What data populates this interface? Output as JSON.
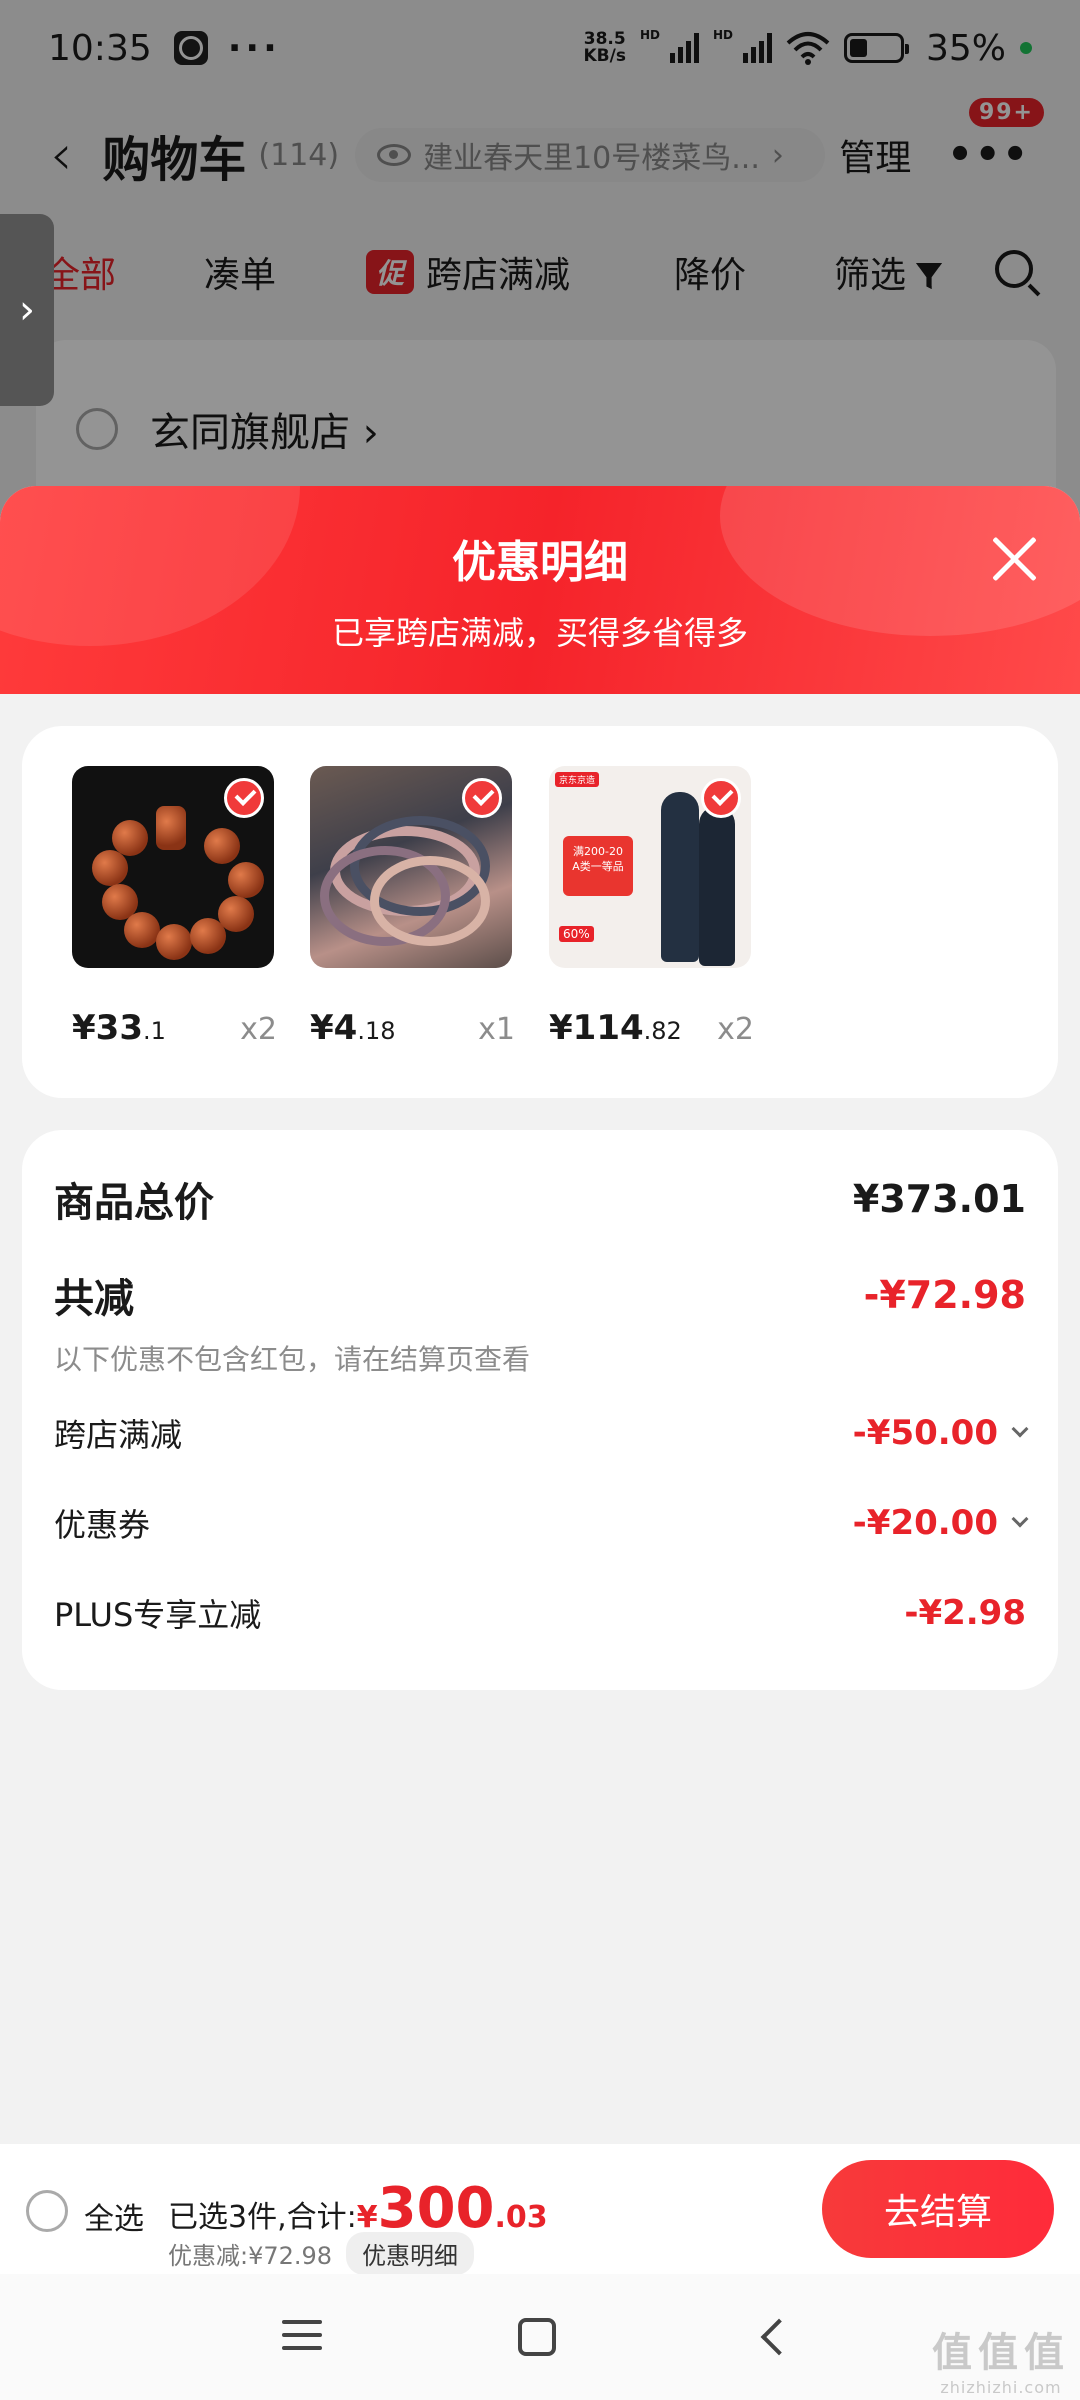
{
  "status_bar": {
    "time": "10:35",
    "dots": "···",
    "net_speed_value": "38.5",
    "net_speed_unit": "KB/s",
    "hd1": "HD",
    "hd2": "HD",
    "battery_percent": "35%",
    "battery_level": 0.35
  },
  "header": {
    "back_glyph": "‹",
    "title": "购物车",
    "count": "(114)",
    "address": "建业春天里10号楼菜鸟...",
    "address_chevron": "›",
    "manage": "管理",
    "more_glyph": "•••",
    "badge": "99+"
  },
  "filter_tabs": [
    {
      "label": "全部"
    },
    {
      "label": "凑单"
    },
    {
      "label": "跨店满减",
      "tag": "促"
    },
    {
      "label": "降价"
    },
    {
      "label": "筛选"
    }
  ],
  "side_tab_glyph": "›",
  "store": {
    "name": "玄同旗舰店 ›"
  },
  "sheet": {
    "title": "优惠明细",
    "subtitle": "已享跨店满减，买得多省得多"
  },
  "products": [
    {
      "price_int": "¥33",
      "price_dec": ".1",
      "qty": "x2",
      "icon": "bracelet"
    },
    {
      "price_int": "¥4",
      "price_dec": ".18",
      "qty": "x1",
      "icon": "hair-ties"
    },
    {
      "price_int": "¥114",
      "price_dec": ".82",
      "qty": "x2",
      "icon": "thermal-underwear"
    }
  ],
  "product_image_text": {
    "brand": "京东京造",
    "promo": "满200-20",
    "promo2": "A类一等品",
    "pct": "60%"
  },
  "summary": {
    "total_label": "商品总价",
    "total_value": "¥373.01",
    "reduce_label": "共减",
    "reduce_value": "-¥72.98",
    "note": "以下优惠不包含红包，请在结算页查看",
    "items": [
      {
        "label": "跨店满减",
        "value": "-¥50.00",
        "expandable": true
      },
      {
        "label": "优惠券",
        "value": "-¥20.00",
        "expandable": true
      },
      {
        "label": "PLUS专享立减",
        "value": "-¥2.98",
        "expandable": false
      }
    ]
  },
  "checkout": {
    "select_all": "全选",
    "selected_text": "已选3件,合计:",
    "currency": "¥",
    "amount_int": "300",
    "amount_dec": ".03",
    "discount_text": "优惠减:¥72.98",
    "detail_button": "优惠明细",
    "checkout_button": "去结算"
  },
  "watermark": {
    "big": "值值值",
    "small": "zhizhizhi.com"
  },
  "colors": {
    "accent": "#e8232a",
    "header_gradient_start": "#ff3b3b",
    "header_gradient_end": "#ff4a4a"
  }
}
